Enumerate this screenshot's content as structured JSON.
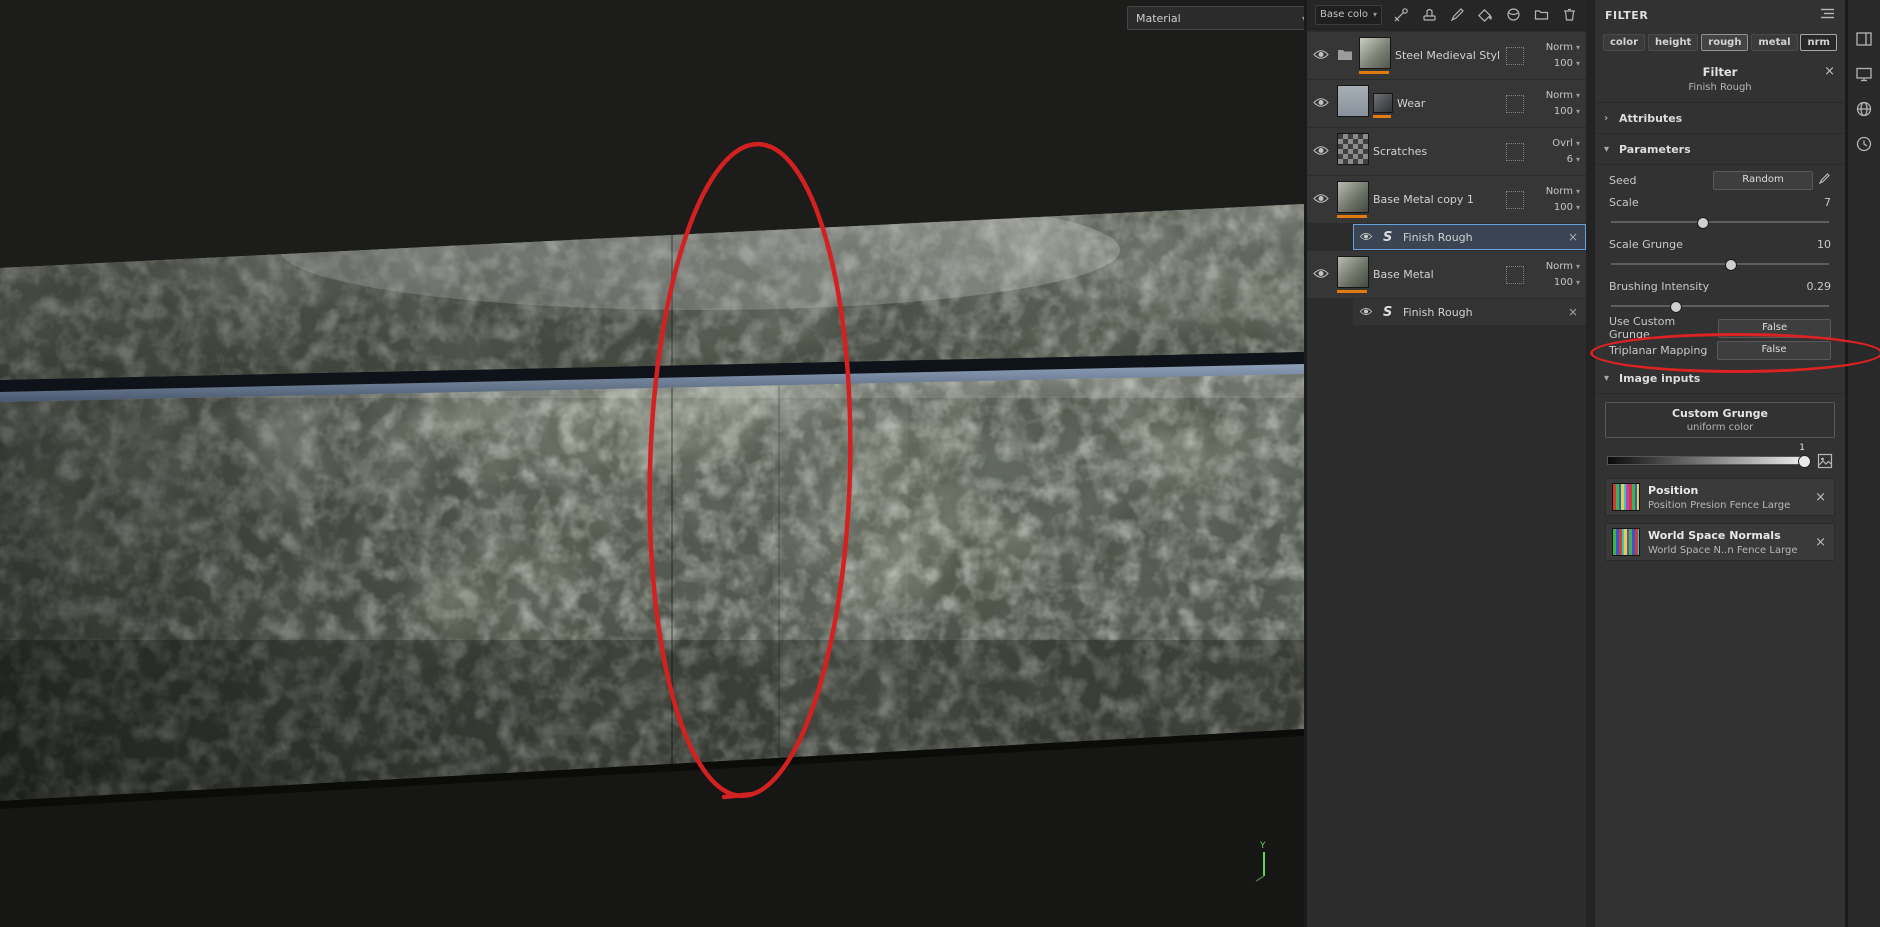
{
  "viewport": {
    "material_dropdown": "Material",
    "gizmo_axis": "Y"
  },
  "layers_toolbar": {
    "channel_dropdown": "Base colo"
  },
  "layers": {
    "rows": [
      {
        "name": "Steel Medieval Stylized",
        "blend": "Norm",
        "opacity": "100"
      },
      {
        "name": "Wear",
        "blend": "Norm",
        "opacity": "100"
      },
      {
        "name": "Scratches",
        "blend": "Ovrl",
        "opacity": "6"
      },
      {
        "name": "Base Metal copy 1",
        "blend": "Norm",
        "opacity": "100"
      },
      {
        "name": "Finish Rough"
      },
      {
        "name": "Base Metal",
        "blend": "Norm",
        "opacity": "100"
      },
      {
        "name": "Finish Rough"
      }
    ]
  },
  "filter_panel": {
    "title": "FILTER",
    "channels": [
      "color",
      "height",
      "rough",
      "metal",
      "nrm"
    ],
    "filter_name": "Filter",
    "filter_subtitle": "Finish Rough",
    "attributes_label": "Attributes",
    "parameters_label": "Parameters",
    "params": {
      "seed_label": "Seed",
      "seed_value": "Random",
      "scale_label": "Scale",
      "scale_value": "7",
      "scale_grunge_label": "Scale Grunge",
      "scale_grunge_value": "10",
      "brushing_label": "Brushing Intensity",
      "brushing_value": "0.29",
      "use_custom_grunge_label": "Use Custom Grunge",
      "use_custom_grunge_value": "False",
      "triplanar_label": "Triplanar Mapping",
      "triplanar_value": "False"
    },
    "image_inputs_label": "Image inputs",
    "custom_grunge": {
      "title": "Custom Grunge",
      "value": "uniform color",
      "slider_value": "1"
    },
    "position": {
      "title": "Position",
      "subtitle": "Position Presion Fence Large"
    },
    "world_space_normals": {
      "title": "World Space Normals",
      "subtitle": "World Space N..n Fence Large"
    }
  },
  "icons": {
    "chevron_down": "▾",
    "close": "×",
    "collapse_right": "›",
    "collapse_down": "▾"
  },
  "colors": {
    "accent_orange": "#e07b12",
    "selection_blue": "#6aa1d8",
    "annotation_red": "#d22222"
  }
}
